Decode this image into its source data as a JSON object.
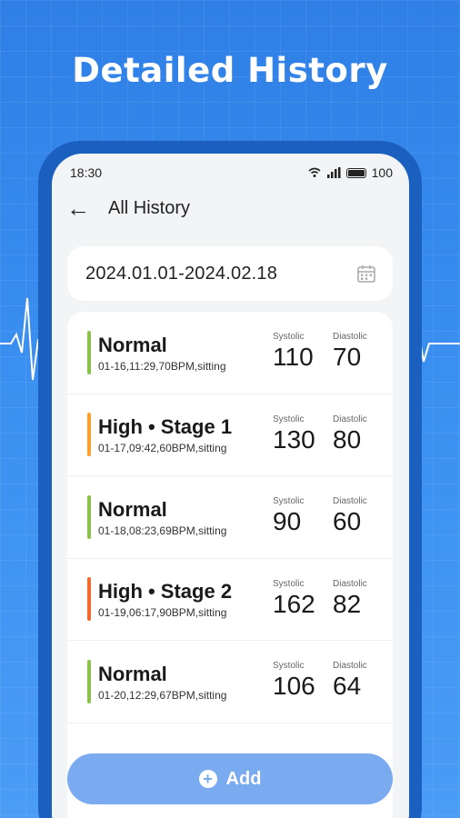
{
  "headline": "Detailed History",
  "status_bar": {
    "time": "18:30",
    "battery": "100"
  },
  "app_bar": {
    "title": "All History"
  },
  "date_range": "2024.01.01-2024.02.18",
  "records": [
    {
      "status": "Normal",
      "meta": "01-16,11:29,70BPM,sitting",
      "color": "#8bc34a",
      "systolic_label": "Systolic",
      "diastolic_label": "Diastolic",
      "systolic": "110",
      "diastolic": "70"
    },
    {
      "status": "High • Stage 1",
      "meta": "01-17,09:42,60BPM,sitting",
      "color": "#ff9f2e",
      "systolic_label": "Systolic",
      "diastolic_label": "Diastolic",
      "systolic": "130",
      "diastolic": "80"
    },
    {
      "status": "Normal",
      "meta": "01-18,08:23,69BPM,sitting",
      "color": "#8bc34a",
      "systolic_label": "Systolic",
      "diastolic_label": "Diastolic",
      "systolic": "90",
      "diastolic": "60"
    },
    {
      "status": "High • Stage 2",
      "meta": "01-19,06:17,90BPM,sitting",
      "color": "#f26a2e",
      "systolic_label": "Systolic",
      "diastolic_label": "Diastolic",
      "systolic": "162",
      "diastolic": "82"
    },
    {
      "status": "Normal",
      "meta": "01-20,12:29,67BPM,sitting",
      "color": "#8bc34a",
      "systolic_label": "Systolic",
      "diastolic_label": "Diastolic",
      "systolic": "106",
      "diastolic": "64"
    }
  ],
  "add_button": {
    "label": "Add"
  },
  "colors": {
    "accent": "#3a8ff0",
    "button": "#7aaaf0"
  }
}
